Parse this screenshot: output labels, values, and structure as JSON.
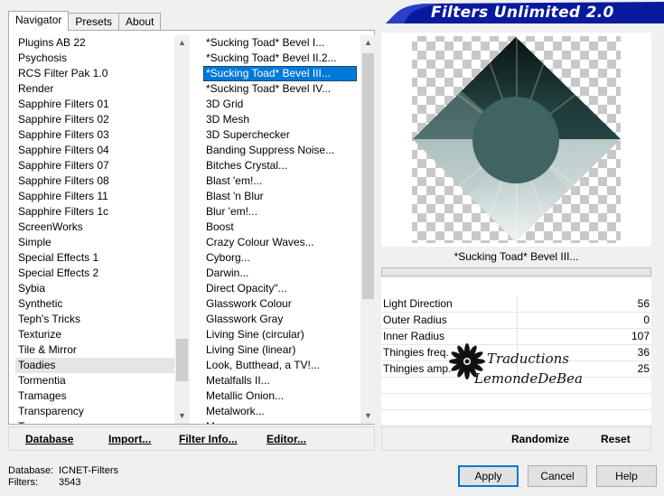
{
  "tabs": [
    {
      "label": "Navigator",
      "active": true
    },
    {
      "label": "Presets",
      "active": false
    },
    {
      "label": "About",
      "active": false
    }
  ],
  "banner": {
    "title": "Filters Unlimited 2.0",
    "color": "#0a1a9e"
  },
  "categories": {
    "items": [
      "Plugins AB 22",
      "Psychosis",
      "RCS Filter Pak 1.0",
      "Render",
      "Sapphire Filters 01",
      "Sapphire Filters 02",
      "Sapphire Filters 03",
      "Sapphire Filters 04",
      "Sapphire Filters 07",
      "Sapphire Filters 08",
      "Sapphire Filters 11",
      "Sapphire Filters 1c",
      "ScreenWorks",
      "Simple",
      "Special Effects 1",
      "Special Effects 2",
      "Sybia",
      "Synthetic",
      "Teph's Tricks",
      "Texturize",
      "Tile & Mirror",
      "Toadies",
      "Tormentia",
      "Tramages",
      "Transparency",
      "Tr..."
    ],
    "selected_index": 21
  },
  "filters": {
    "items": [
      "*Sucking Toad*  Bevel I...",
      "*Sucking Toad*  Bevel II.2...",
      "*Sucking Toad*  Bevel III...",
      "*Sucking Toad*  Bevel IV...",
      "3D Grid",
      "3D Mesh",
      "3D Superchecker",
      "Banding Suppress Noise...",
      "Bitches Crystal...",
      "Blast 'em!...",
      "Blast 'n Blur",
      "Blur 'em!...",
      "Boost",
      "Crazy Colour Waves...",
      "Cyborg...",
      "Darwin...",
      "Direct Opacity\"...",
      "Glasswork Colour",
      "Glasswork Gray",
      "Living Sine (circular)",
      "Living Sine (linear)",
      "Look, Butthead, a TV!...",
      "Metalfalls II...",
      "Metallic Onion...",
      "Metalwork...",
      "M..."
    ],
    "selected_index": 2
  },
  "preview": {
    "filter_name": "*Sucking Toad*  Bevel III...",
    "fill_color": "#3f6462"
  },
  "params": [
    {
      "label": "Light Direction",
      "value": "56"
    },
    {
      "label": "Outer Radius",
      "value": "0"
    },
    {
      "label": "Inner Radius",
      "value": "107"
    },
    {
      "label": "Thingies freq.",
      "value": "36"
    },
    {
      "label": "Thingies amp.",
      "value": "25"
    }
  ],
  "watermark": {
    "line1": "Traductions",
    "line2": "LemondeDeBea"
  },
  "bottom_buttons": {
    "database": "Database",
    "import": "Import...",
    "filter_info": "Filter Info...",
    "editor": "Editor...",
    "randomize": "Randomize",
    "reset": "Reset"
  },
  "status": {
    "database_label": "Database:",
    "database_value": "ICNET-Filters",
    "filters_label": "Filters:",
    "filters_value": "3543"
  },
  "dialog_buttons": {
    "apply": "Apply",
    "cancel": "Cancel",
    "help": "Help"
  },
  "icons": {
    "scroll_up": "scroll-up-icon",
    "scroll_down": "scroll-down-icon"
  }
}
